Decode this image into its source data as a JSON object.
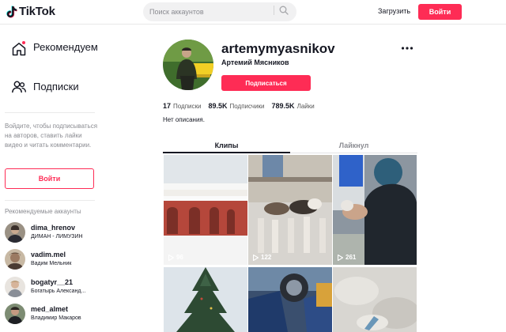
{
  "header": {
    "logo_text": "TikTok",
    "search_placeholder": "Поиск аккаунтов",
    "upload_label": "Загрузить",
    "login_label": "Войти"
  },
  "sidebar": {
    "nav": [
      {
        "label": "Рекомендуем",
        "icon": "home-icon"
      },
      {
        "label": "Подписки",
        "icon": "users-icon"
      }
    ],
    "login_hint": "Войдите, чтобы подписываться на авторов, ставить лайки видео и читать комментарии.",
    "login_button": "Войти",
    "suggested_title": "Рекомендуемые аккаунты",
    "accounts": [
      {
        "username": "dima_hrenov",
        "display_name": "ДИМАН - ЛИМУЗИН"
      },
      {
        "username": "vadim.mel",
        "display_name": "Вадим Мельник"
      },
      {
        "username": "bogatyr__21",
        "display_name": "Богатырь Александ..."
      },
      {
        "username": "med_almet",
        "display_name": "Владимир Макаров"
      }
    ]
  },
  "profile": {
    "username": "artemymyasnikov",
    "full_name": "Артемий Мясников",
    "subscribe_label": "Подписаться",
    "stats": [
      {
        "value": "17",
        "label": "Подписки"
      },
      {
        "value": "89.5K",
        "label": "Подписчики"
      },
      {
        "value": "789.5K",
        "label": "Лайки"
      }
    ],
    "bio": "Нет описания."
  },
  "tabs": [
    {
      "label": "Клипы",
      "active": true
    },
    {
      "label": "Лайкнул",
      "active": false
    }
  ],
  "videos": [
    {
      "views": "96"
    },
    {
      "views": "122"
    },
    {
      "views": "261"
    },
    {
      "views": ""
    },
    {
      "views": ""
    },
    {
      "views": ""
    }
  ],
  "colors": {
    "accent": "#fe2c55",
    "text": "#161823",
    "muted": "#8a8b91"
  }
}
